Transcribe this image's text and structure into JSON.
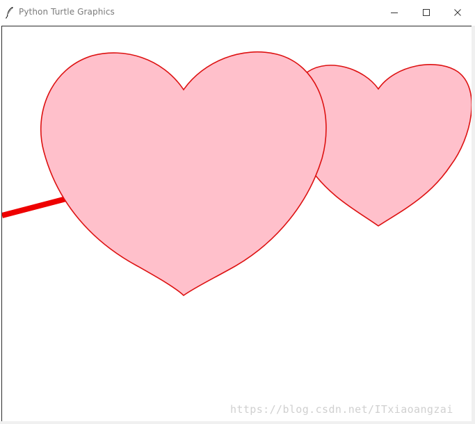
{
  "window": {
    "title": "Python Turtle Graphics",
    "icons": {
      "app": "feather-icon",
      "minimize": "minimize-icon",
      "maximize": "maximize-icon",
      "close": "close-icon"
    }
  },
  "canvas": {
    "background": "#ffffff",
    "heart_fill": "#ffc0cb",
    "heart_outline": "#dd1111",
    "arrow_color": "#ee0000",
    "watermark": "https://blog.csdn.net/ITxiaoangzai"
  }
}
